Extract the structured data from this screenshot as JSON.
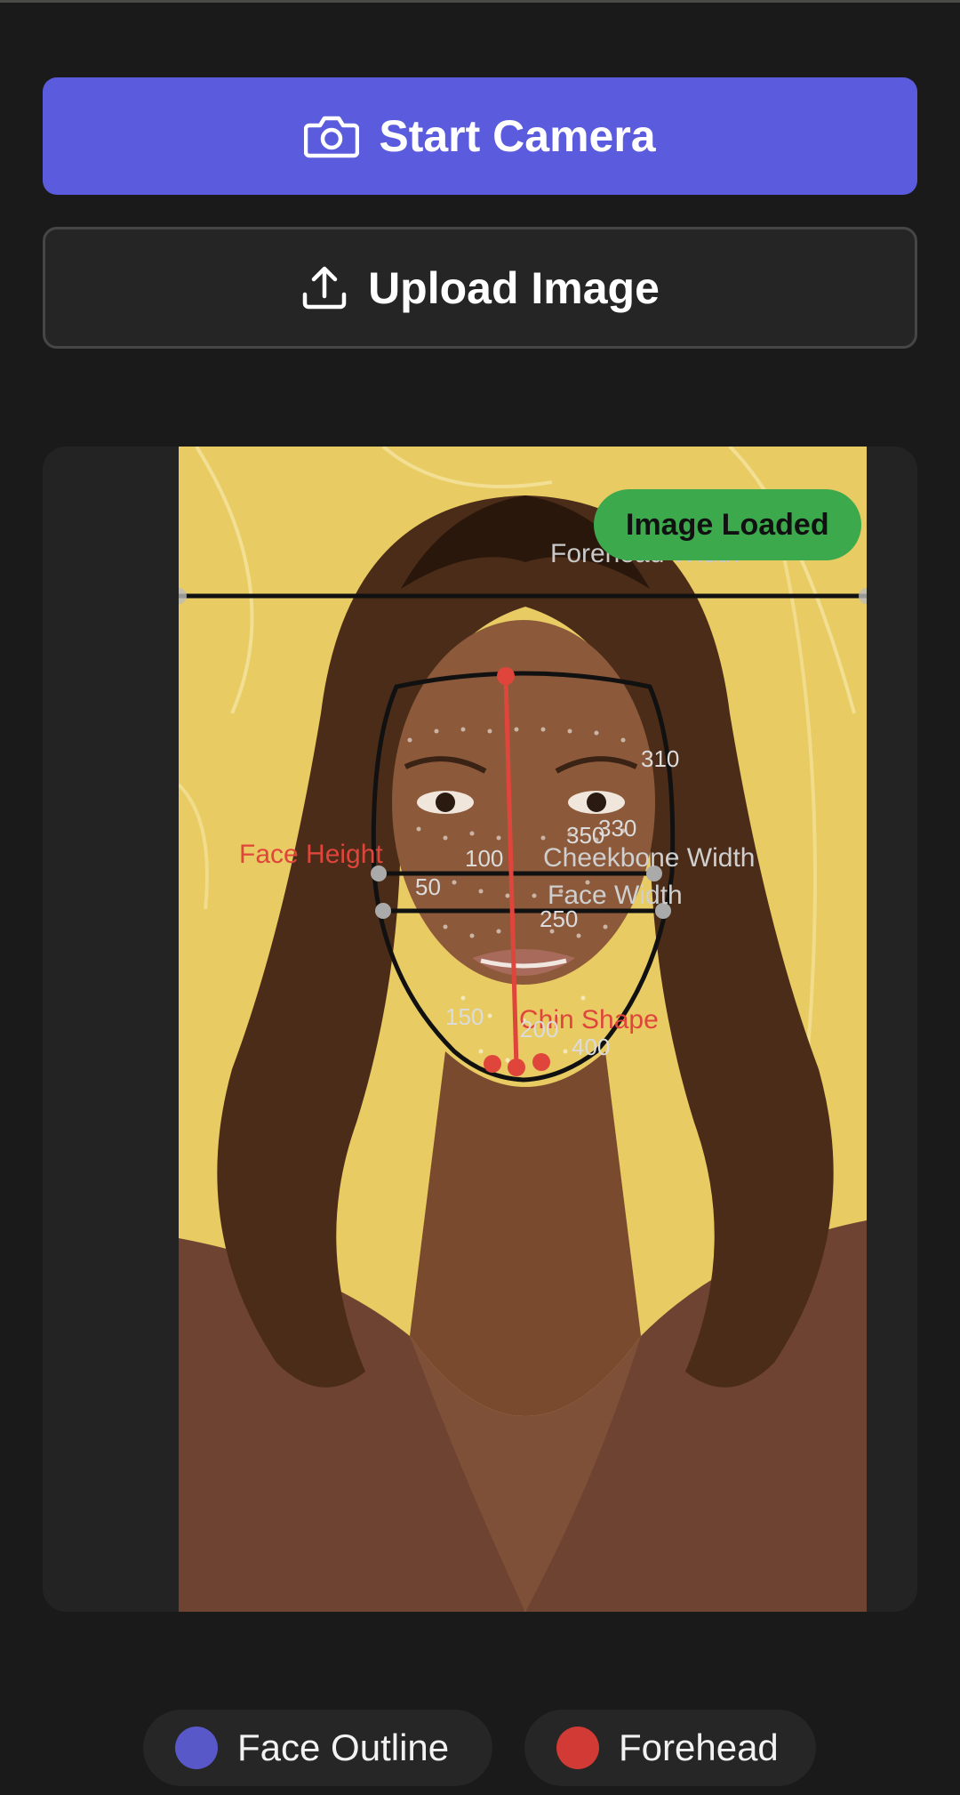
{
  "buttons": {
    "start_camera": "Start Camera",
    "upload_image": "Upload Image"
  },
  "preview": {
    "status_badge": "Image Loaded",
    "overlay_labels": {
      "forehead_width": "Forehead Width",
      "cheekbone_width": "Cheekbone Width",
      "face_width": "Face Width",
      "face_height": "Face Height",
      "chin_shape": "Chin Shape"
    },
    "landmark_index_labels": [
      "310",
      "350",
      "330",
      "100",
      "50",
      "250",
      "150",
      "200",
      "400"
    ]
  },
  "legend": [
    {
      "label": "Face Outline",
      "color": "#5858c8"
    },
    {
      "label": "Forehead",
      "color": "#d23a35"
    }
  ],
  "icons": {
    "camera": "camera-icon",
    "upload": "upload-icon"
  },
  "colors": {
    "primary": "#5b5bde",
    "success": "#3caa4c",
    "measure_red": "#e0453c",
    "background": "#1a1a1a"
  }
}
